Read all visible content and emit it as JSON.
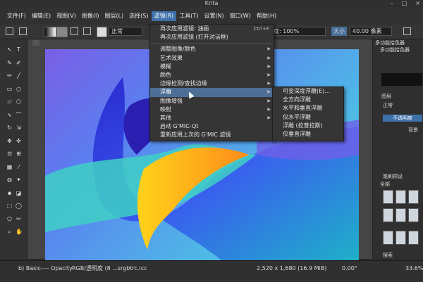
{
  "app": {
    "title": "Krita"
  },
  "menubar": {
    "items": [
      {
        "label": "文件(F)"
      },
      {
        "label": "编辑(E)"
      },
      {
        "label": "视图(V)"
      },
      {
        "label": "图像(I)"
      },
      {
        "label": "图层(L)"
      },
      {
        "label": "选择(S)"
      },
      {
        "label": "滤镜(R)",
        "active": true
      },
      {
        "label": "工具(T)"
      },
      {
        "label": "设置(N)"
      },
      {
        "label": "窗口(W)"
      },
      {
        "label": "帮助(H)"
      }
    ]
  },
  "toolbar": {
    "brush_preset_label": "正常",
    "opacity_value": "度: 100%",
    "size_label": "大小",
    "size_value": "40.00 像素"
  },
  "filter_menu": {
    "items": [
      {
        "label": "再次应用滤镜: 油画",
        "shortcut": "Ctrl+F"
      },
      {
        "label": "再次应用滤镜 (打开对话框)",
        "shortcut": ""
      },
      {
        "sep": true
      },
      {
        "label": "调整图像/颜色",
        "submenu": true
      },
      {
        "label": "艺术效果",
        "submenu": true
      },
      {
        "label": "模糊",
        "submenu": true
      },
      {
        "label": "颜色",
        "submenu": true
      },
      {
        "label": "边缘检测/查找边缘",
        "submenu": true
      },
      {
        "label": "浮雕",
        "submenu": true,
        "highlighted": true
      },
      {
        "label": "图像增强",
        "submenu": true
      },
      {
        "label": "映射",
        "submenu": true
      },
      {
        "label": "其他",
        "submenu": true
      },
      {
        "label": "启动 G'MIC-Qt",
        "submenu": false
      },
      {
        "label": "重新应用上次的 G'MIC 滤镜",
        "submenu": false
      }
    ]
  },
  "emboss_submenu": {
    "items": [
      {
        "label": "可变深度浮雕(E)..."
      },
      {
        "label": "全方向浮雕"
      },
      {
        "label": "水平和垂直浮雕"
      },
      {
        "label": "仅水平浮雕"
      },
      {
        "label": "浮雕 (拉普拉斯)"
      },
      {
        "label": "仅垂直浮雕"
      }
    ]
  },
  "dock": {
    "color_selector_title": "多功能拾色器",
    "color_selector_tab": "多功能拾色器",
    "layers_title": "图层",
    "blend_mode": "正常",
    "opacity_button": "不透明度",
    "layer_name": "背景",
    "brush_presets_title": "笔刷预设",
    "brush_tag": "全部",
    "search_label": "搜索"
  },
  "statusbar": {
    "brush_info": "b) Basic---- Opacity",
    "color_space": "RGB/透明度 (8 ...srgbtrc.icc",
    "image_size": "2,520 x 1,680 (16.9 MiB)",
    "rotation": "0.00°",
    "zoom": "33.6%"
  }
}
